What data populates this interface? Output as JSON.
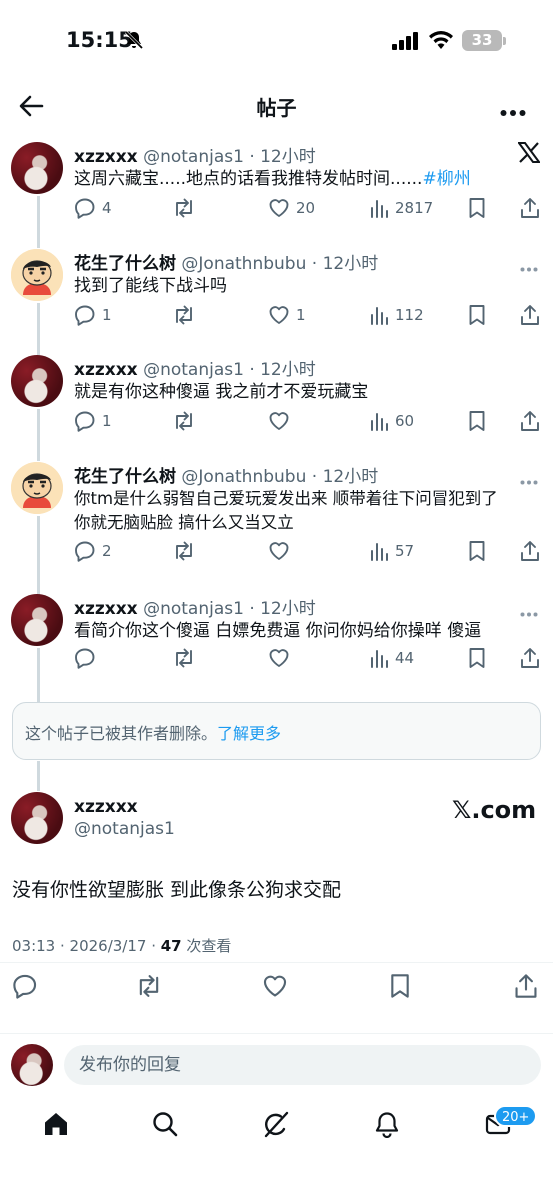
{
  "status": {
    "time": "15:15",
    "battery": "33"
  },
  "header": {
    "title": "帖子"
  },
  "posts": [
    {
      "name": "xzzxxx",
      "handle": "@notanjas1 · 12小时",
      "text": "这周六藏宝.....地点的话看我推特发帖时间......",
      "hashtag": "#柳州",
      "replies": "4",
      "reposts": "",
      "likes": "20",
      "views": "2817"
    },
    {
      "name": "花生了什么树",
      "handle": "@Jonathnbubu · 12小时",
      "text": "找到了能线下战斗吗",
      "replies": "1",
      "reposts": "",
      "likes": "1",
      "views": "112"
    },
    {
      "name": "xzzxxx",
      "handle": "@notanjas1 · 12小时",
      "text": "就是有你这种傻逼 我之前才不爱玩藏宝",
      "replies": "1",
      "reposts": "",
      "likes": "",
      "views": "60"
    },
    {
      "name": "花生了什么树",
      "handle": "@Jonathnbubu · 12小时",
      "text_line1": "你tm是什么弱智自己爱玩爱发出来 顺带着往下问冒犯到了",
      "text_line2": "你就无脑贴脸 搞什么又当又立",
      "replies": "2",
      "reposts": "",
      "likes": "",
      "views": "57"
    },
    {
      "name": "xzzxxx",
      "handle": "@notanjas1 · 12小时",
      "text": "看简介你这个傻逼 白嫖免费逼 你问你妈给你操咩 傻逼",
      "replies": "",
      "reposts": "",
      "likes": "",
      "views": "44"
    }
  ],
  "deleted_notice": {
    "text": "这个帖子已被其作者删除。",
    "link": "了解更多"
  },
  "main_post": {
    "name": "xzzxxx",
    "handle": "@notanjas1",
    "source": "𝕏.com",
    "text": "没有你性欲望膨胀 到此像条公狗求交配",
    "timestamp": "03:13 · 2026/3/17 · ",
    "views_count": "47",
    "views_label": " 次查看"
  },
  "reply_box": {
    "placeholder": "发布你的回复"
  },
  "tabbar": {
    "badge": "20+"
  },
  "colors": {
    "accent": "#1d9bf0",
    "secondary_text": "#536471",
    "thread_line": "#cfd9de"
  }
}
